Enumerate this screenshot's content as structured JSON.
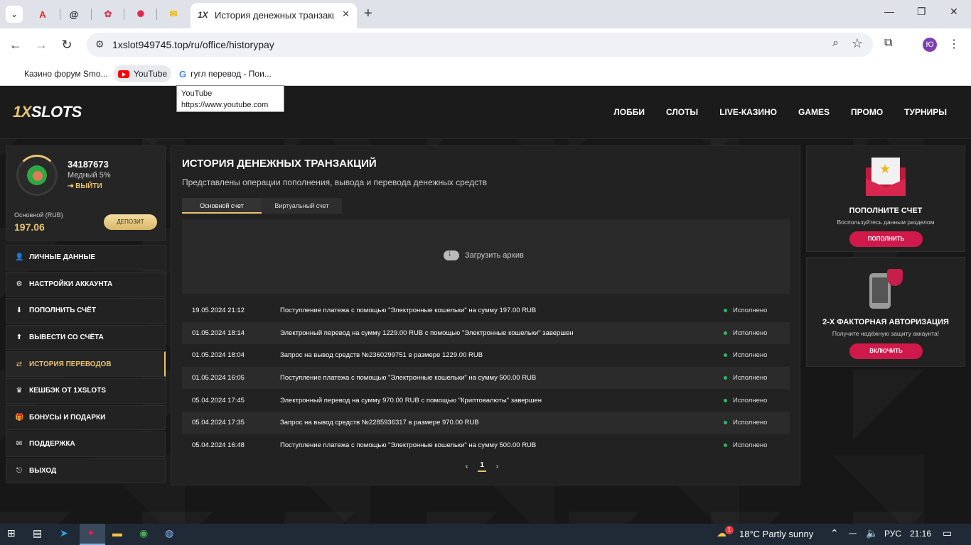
{
  "browser": {
    "tab_dropdown_icon": "chevron-down-icon",
    "pinned_tabs": [
      {
        "icon": "acrobat-icon",
        "glyph": "A",
        "color": "#e12b2b"
      },
      {
        "icon": "threads-icon",
        "glyph": "@",
        "color": "#111111"
      },
      {
        "icon": "gift-icon",
        "glyph": "✿",
        "color": "#d63a5a"
      },
      {
        "icon": "spinner-icon",
        "glyph": "✺",
        "color": "#e0254a"
      },
      {
        "icon": "mail-icon",
        "glyph": "✉",
        "color": "#f0b400"
      }
    ],
    "active_tab_favicon": "1X",
    "active_tab_title": "История денежных транзакци",
    "close_glyph": "✕",
    "newtab_glyph": "+",
    "minimize_glyph": "—",
    "restore_glyph": "❐",
    "window_close_glyph": "✕",
    "back_glyph": "←",
    "forward_glyph": "→",
    "reload_glyph": "↻",
    "url": "1xslot949745.top/ru/office/historypay",
    "zoom_glyph": "⌕",
    "star_glyph": "☆",
    "extensions_glyph": "⧉",
    "profile_initial": "Ю",
    "menu_glyph": "⋮"
  },
  "bookmarks": [
    {
      "label": "Казино форум Smo..."
    },
    {
      "label": "YouTube"
    },
    {
      "label": "гугл перевод - Пои..."
    }
  ],
  "tooltip": {
    "title": "YouTube",
    "url": "https://www.youtube.com"
  },
  "site": {
    "logo_part1": "1X",
    "logo_part2": "SLOTS",
    "nav": [
      "ЛОББИ",
      "СЛОТЫ",
      "LIVE-КАЗИНО",
      "GAMES",
      "ПРОМО",
      "ТУРНИРЫ"
    ],
    "profile": {
      "user_id": "34187673",
      "rank": "Медный 5%",
      "logout": "ВЫЙТИ",
      "balance_label": "Основной (RUB)",
      "balance_value": "197.06",
      "deposit_label": "ДЕПОЗИТ"
    },
    "menu": [
      {
        "label": "ЛИЧНЫЕ ДАННЫЕ",
        "icon": "user-plus-icon",
        "glyph": "👤",
        "active": false
      },
      {
        "label": "НАСТРОЙКИ АККАУНТА",
        "icon": "gears-icon",
        "glyph": "⚙",
        "active": false
      },
      {
        "label": "ПОПОЛНИТЬ СЧЁТ",
        "icon": "download-icon",
        "glyph": "⬇",
        "active": false
      },
      {
        "label": "ВЫВЕСТИ СО СЧЁТА",
        "icon": "upload-icon",
        "glyph": "⬆",
        "active": false
      },
      {
        "label": "ИСТОРИЯ ПЕРЕВОДОВ",
        "icon": "transfer-icon",
        "glyph": "⇄",
        "active": true
      },
      {
        "label": "КЕШБЭК ОТ 1XSLOTS",
        "icon": "crown-icon",
        "glyph": "♛",
        "active": false
      },
      {
        "label": "БОНУСЫ И ПОДАРКИ",
        "icon": "gift-icon",
        "glyph": "🎁",
        "active": false
      },
      {
        "label": "ПОДДЕРЖКА",
        "icon": "envelope-icon",
        "glyph": "✉",
        "active": false
      },
      {
        "label": "ВЫХОД",
        "icon": "sign-out-icon",
        "glyph": "⎋",
        "active": false
      }
    ],
    "main": {
      "title": "ИСТОРИЯ ДЕНЕЖНЫХ ТРАНЗАКЦИЙ",
      "subtitle": "Представлены операции пополнения, вывода и перевода денежных средств",
      "tab_main": "Основной счет",
      "tab_virtual": "Виртуальный счет",
      "archive_label": "Загрузить архив",
      "transactions": [
        {
          "date": "19.05.2024 21:12",
          "desc": "Поступление платежа с помощью \"Электронные кошельки\" на сумму 197.00 RUB",
          "status": "Исполнено"
        },
        {
          "date": "01.05.2024 18:14",
          "desc": "Электронный перевод на сумму 1229.00 RUB с помощью \"Электронные кошельки\" завершен",
          "status": "Исполнено"
        },
        {
          "date": "01.05.2024 18:04",
          "desc": "Запрос на вывод средств №2360299751 в размере 1229.00 RUB",
          "status": "Исполнено"
        },
        {
          "date": "01.05.2024 16:05",
          "desc": "Поступление платежа с помощью \"Электронные кошельки\" на сумму 500.00 RUB",
          "status": "Исполнено"
        },
        {
          "date": "05.04.2024 17:45",
          "desc": "Электронный перевод на сумму 970.00 RUB с помощью \"Криптовалюты\" завершен",
          "status": "Исполнено"
        },
        {
          "date": "05.04.2024 17:35",
          "desc": "Запрос на вывод средств №2285936317 в размере 970.00 RUB",
          "status": "Исполнено"
        },
        {
          "date": "05.04.2024 16:48",
          "desc": "Поступление платежа с помощью \"Электронные кошельки\" на сумму 500.00 RUB",
          "status": "Исполнено"
        }
      ],
      "pager": {
        "prev": "‹",
        "page": "1",
        "next": "›"
      }
    },
    "promo1": {
      "title": "ПОПОЛНИТЕ СЧЕТ",
      "subtitle": "Воспользуйтесь данным разделом",
      "button": "ПОПОЛНИТЬ"
    },
    "promo2": {
      "title": "2-Х ФАКТОРНАЯ АВТОРИЗАЦИЯ",
      "subtitle": "Получите надёжную защиту аккаунта!",
      "button": "ВКЛЮЧИТЬ"
    },
    "accent_color": "#e8c371",
    "button_color": "#d0194b"
  },
  "taskbar": {
    "weather": "18°C  Partly sunny",
    "weather_badge": "1",
    "lang": "РУС",
    "time": "21:16"
  }
}
